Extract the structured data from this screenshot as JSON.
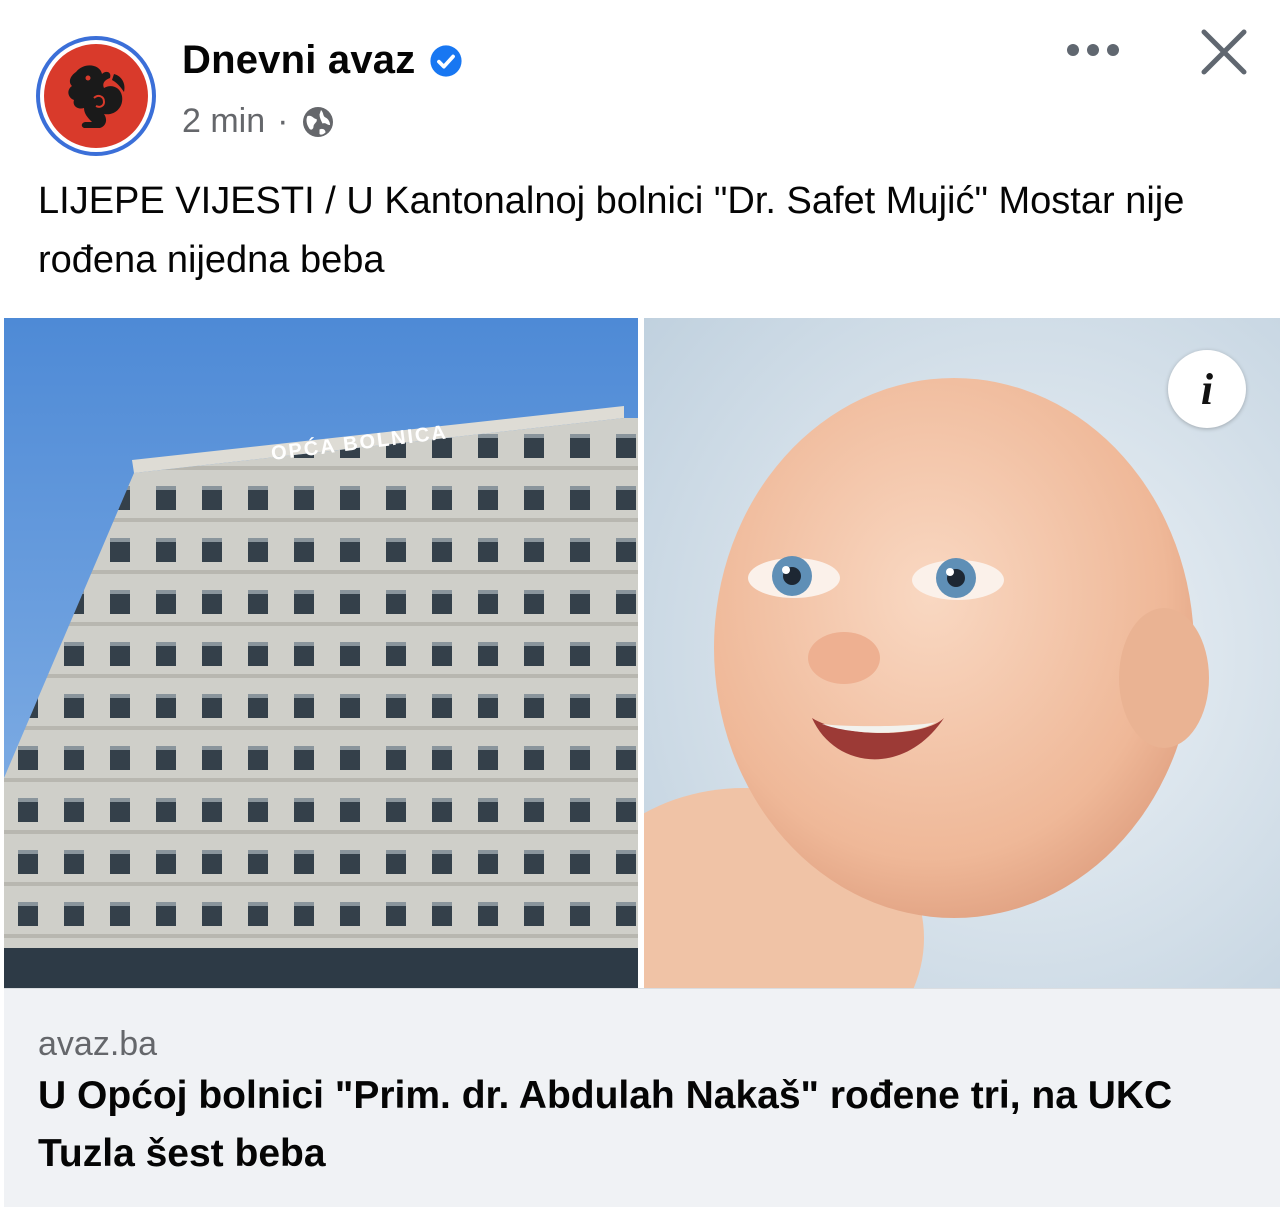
{
  "header": {
    "page_name": "Dnevni avaz",
    "time": "2 min",
    "separator": "·",
    "verified_icon": "verified-badge-icon",
    "privacy_icon": "globe-icon"
  },
  "actions": {
    "more_icon": "more-dots-icon",
    "close_icon": "close-icon"
  },
  "post": {
    "text": "LIJEPE VIJESTI / U Kantonalnoj bolnici \"Dr. Safet Mujić\" Mostar nije rođena nijedna beba"
  },
  "media": {
    "hospital_sign": "OPĆA BOLNICA",
    "info_label": "i"
  },
  "link": {
    "domain": "avaz.ba",
    "title": "U Općoj bolnici \"Prim. dr. Abdulah Nakaš\" rođene tri, na UKC Tuzla šest beba"
  },
  "colors": {
    "brand_red": "#d93a2b",
    "ring_blue": "#3b6fd8",
    "verified_blue": "#1877f2",
    "meta_gray": "#65676b",
    "card_bg": "#f0f2f5"
  }
}
